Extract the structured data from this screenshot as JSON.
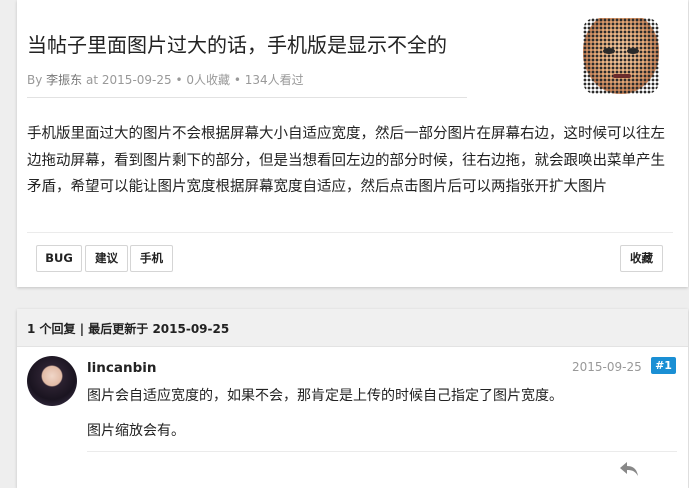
{
  "topic": {
    "title": "当帖子里面图片过大的话，手机版是显示不全的",
    "meta": {
      "by": "By",
      "author": "李振东",
      "at": "at",
      "date": "2015-09-25",
      "sep": "•",
      "favorites": "0人收藏",
      "views": "134人看过"
    },
    "content": "手机版里面过大的图片不会根据屏幕大小自适应宽度，然后一部分图片在屏幕右边，这时候可以往左边拖动屏幕，看到图片剩下的部分，但是当想看回左边的部分时候，往右边拖，就会跟唤出菜单产生矛盾，希望可以能让图片宽度根据屏幕宽度自适应，然后点击图片后可以两指张开扩大图片",
    "tags": [
      "BUG",
      "建议",
      "手机"
    ],
    "favorite_label": "收藏"
  },
  "replies": {
    "summary": "1 个回复 | 最后更新于 2015-09-25",
    "items": [
      {
        "name": "lincanbin",
        "date": "2015-09-25",
        "floor": "#1",
        "lines": [
          "图片会自适应宽度的，如果不会，那肯定是上传的时候自己指定了图片宽度。",
          "图片缩放会有。"
        ]
      }
    ]
  },
  "colors": {
    "floor_badge": "#1a8fd4",
    "page_bg": "#eeeeee"
  },
  "icons": {
    "reply": "reply-icon"
  }
}
